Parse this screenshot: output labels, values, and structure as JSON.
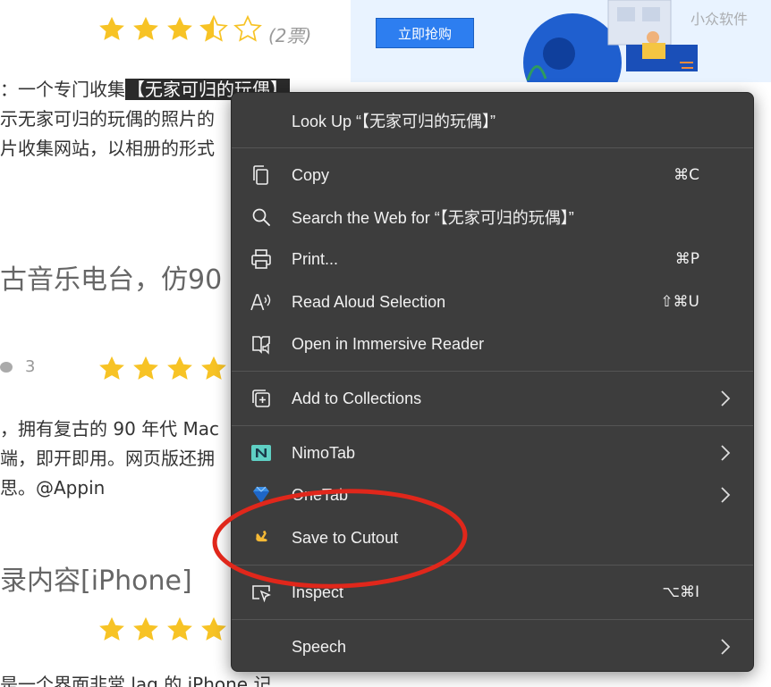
{
  "background": {
    "rating_top": {
      "votes": "(2票)"
    },
    "paragraph1": {
      "line1_prefix": "：一个专门收集",
      "line1_selected": "【无家可归的玩偶】",
      "line2": "示无家可归的玩偶的照片的",
      "line3": "片收集网站，以相册的形式"
    },
    "heading1": "古音乐电台，仿90",
    "comment_count": "3",
    "paragraph2": {
      "line1": "，拥有复古的 90 年代 Mac",
      "line2": "端，即开即用。网页版还拥",
      "line3": "思。@Appin"
    },
    "heading2": "录内容[iPhone]",
    "paragraph3_line1": "是一个界面非常 lag 的 iPhone 记",
    "banner": {
      "button_label": "立即抢购",
      "watermark": "小众软件"
    }
  },
  "context_menu": {
    "items": [
      {
        "label": "Look Up “【无家可归的玩偶】”",
        "shortcut": "",
        "icon": "none"
      },
      {
        "label": "Copy",
        "shortcut": "⌘C",
        "icon": "copy-icon"
      },
      {
        "label": "Search the Web for “【无家可归的玩偶】”",
        "shortcut": "",
        "icon": "search-icon"
      },
      {
        "label": "Print...",
        "shortcut": "⌘P",
        "icon": "printer-icon"
      },
      {
        "label": "Read Aloud Selection",
        "shortcut": "⇧⌘U",
        "icon": "read-aloud-icon"
      },
      {
        "label": "Open in Immersive Reader",
        "shortcut": "",
        "icon": "immersive-reader-icon"
      },
      {
        "label": "Add to Collections",
        "shortcut": "",
        "icon": "collections-icon",
        "submenu": true
      },
      {
        "label": "NimoTab",
        "shortcut": "",
        "icon": "nimotab-icon",
        "submenu": true
      },
      {
        "label": "OneTab",
        "shortcut": "",
        "icon": "onetab-icon",
        "submenu": true
      },
      {
        "label": "Save to Cutout",
        "shortcut": "",
        "icon": "cutout-icon"
      },
      {
        "label": "Inspect",
        "shortcut": "⌥⌘I",
        "icon": "inspect-icon"
      },
      {
        "label": "Speech",
        "shortcut": "",
        "icon": "none",
        "submenu": true
      }
    ]
  },
  "colors": {
    "menu_bg": "#3d3d3d",
    "menu_text": "#f1f1f1",
    "star": "#f7c325",
    "annotation_circle": "#e0271b",
    "banner_button": "#2d7ef0"
  }
}
